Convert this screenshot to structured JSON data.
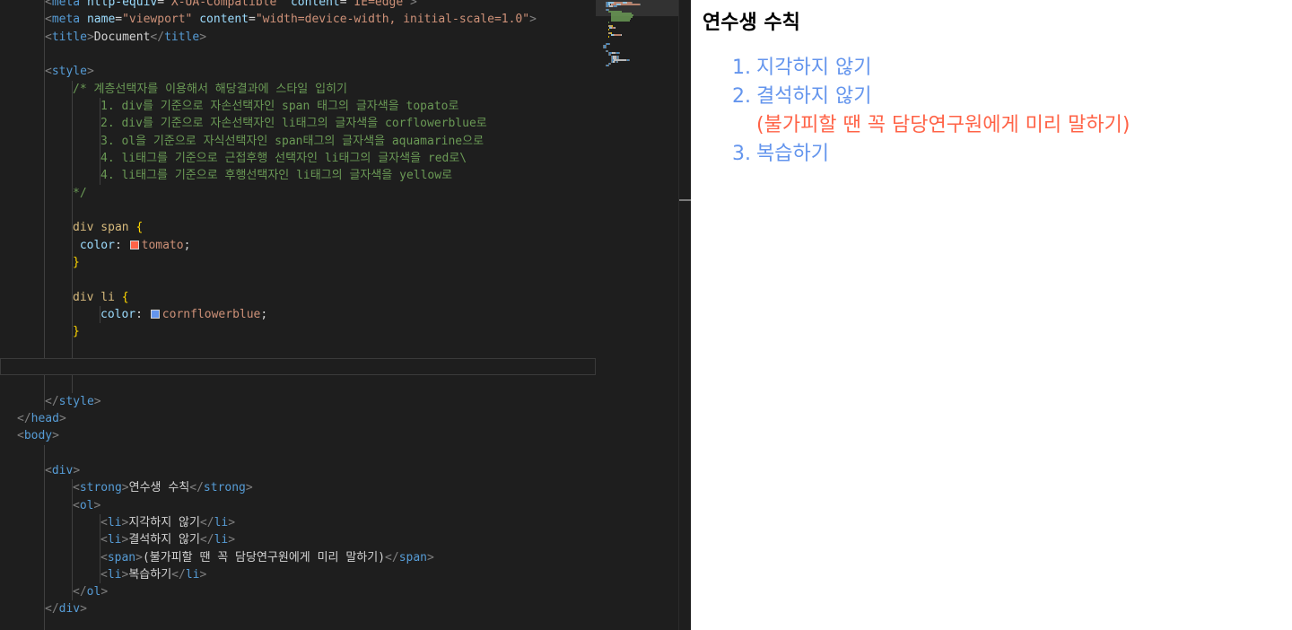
{
  "code_lines": [
    {
      "indent": 1,
      "tokens": [
        [
          "punc",
          "<"
        ],
        [
          "tag",
          "meta"
        ],
        [
          "text",
          " "
        ],
        [
          "attr",
          "http-equiv"
        ],
        [
          "text",
          "="
        ],
        [
          "str",
          "\"X-UA-Compatible\""
        ],
        [
          "text",
          " "
        ],
        [
          "attr",
          "content"
        ],
        [
          "text",
          "="
        ],
        [
          "str",
          "\"IE=edge\""
        ],
        [
          "punc",
          ">"
        ]
      ]
    },
    {
      "indent": 1,
      "tokens": [
        [
          "punc",
          "<"
        ],
        [
          "tag",
          "meta"
        ],
        [
          "text",
          " "
        ],
        [
          "attr",
          "name"
        ],
        [
          "text",
          "="
        ],
        [
          "str",
          "\"viewport\""
        ],
        [
          "text",
          " "
        ],
        [
          "attr",
          "content"
        ],
        [
          "text",
          "="
        ],
        [
          "str",
          "\"width=device-width, initial-scale=1.0\""
        ],
        [
          "punc",
          ">"
        ]
      ]
    },
    {
      "indent": 1,
      "tokens": [
        [
          "punc",
          "<"
        ],
        [
          "tag",
          "title"
        ],
        [
          "punc",
          ">"
        ],
        [
          "text",
          "Document"
        ],
        [
          "punc",
          "</"
        ],
        [
          "tag",
          "title"
        ],
        [
          "punc",
          ">"
        ]
      ]
    },
    {
      "indent": 1,
      "tokens": []
    },
    {
      "indent": 1,
      "tokens": [
        [
          "punc",
          "<"
        ],
        [
          "tag",
          "style"
        ],
        [
          "punc",
          ">"
        ]
      ]
    },
    {
      "indent": 2,
      "tokens": [
        [
          "com",
          "/* 계층선택자를 이용해서 해당결과에 스타일 입히기"
        ]
      ]
    },
    {
      "indent": 3,
      "tokens": [
        [
          "com",
          "1. div를 기준으로 자손선택자인 span 태그의 글자색을 topato로"
        ]
      ]
    },
    {
      "indent": 3,
      "tokens": [
        [
          "com",
          "2. div를 기준으로 자손선택자인 li태그의 글자색을 corflowerblue로"
        ]
      ]
    },
    {
      "indent": 3,
      "tokens": [
        [
          "com",
          "3. ol을 기준으로 자식선택자인 span태그의 글자색을 aquamarine으로"
        ]
      ]
    },
    {
      "indent": 3,
      "tokens": [
        [
          "com",
          "4. li태그를 기준으로 근접후행 선택자인 li태그의 글자색을 red로\\"
        ]
      ]
    },
    {
      "indent": 3,
      "tokens": [
        [
          "com",
          "4. li태그를 기준으로 후행선택자인 li태그의 글자색을 yellow로"
        ]
      ]
    },
    {
      "indent": 2,
      "tokens": [
        [
          "com",
          "*/"
        ]
      ]
    },
    {
      "indent": 2,
      "tokens": []
    },
    {
      "indent": 2,
      "tokens": [
        [
          "sel",
          "div span "
        ],
        [
          "brace",
          "{"
        ]
      ]
    },
    {
      "indent": 2,
      "tokens": [
        [
          "text",
          " "
        ],
        [
          "prop",
          "color"
        ],
        [
          "text",
          ": "
        ],
        [
          "swatch",
          "#ff6347"
        ],
        [
          "val",
          "tomato"
        ],
        [
          "text",
          ";"
        ]
      ]
    },
    {
      "indent": 2,
      "tokens": [
        [
          "brace",
          "}"
        ]
      ]
    },
    {
      "indent": 2,
      "tokens": []
    },
    {
      "indent": 2,
      "tokens": [
        [
          "sel",
          "div li "
        ],
        [
          "brace",
          "{"
        ]
      ]
    },
    {
      "indent": 3,
      "tokens": [
        [
          "prop",
          "color"
        ],
        [
          "text",
          ": "
        ],
        [
          "swatch",
          "#6495ed"
        ],
        [
          "val",
          "cornflowerblue"
        ],
        [
          "text",
          ";"
        ]
      ]
    },
    {
      "indent": 2,
      "tokens": [
        [
          "brace",
          "}"
        ]
      ]
    },
    {
      "indent": 2,
      "tokens": []
    },
    {
      "indent": 0,
      "tokens": [],
      "cursor": true
    },
    {
      "indent": 2,
      "tokens": []
    },
    {
      "indent": 1,
      "tokens": [
        [
          "punc",
          "</"
        ],
        [
          "tag",
          "style"
        ],
        [
          "punc",
          ">"
        ]
      ]
    },
    {
      "indent": 0,
      "tokens": [
        [
          "punc",
          "</"
        ],
        [
          "tag",
          "head"
        ],
        [
          "punc",
          ">"
        ]
      ]
    },
    {
      "indent": 0,
      "tokens": [
        [
          "punc",
          "<"
        ],
        [
          "tag",
          "body"
        ],
        [
          "punc",
          ">"
        ]
      ]
    },
    {
      "indent": 1,
      "tokens": []
    },
    {
      "indent": 1,
      "tokens": [
        [
          "punc",
          "<"
        ],
        [
          "tag",
          "div"
        ],
        [
          "punc",
          ">"
        ]
      ]
    },
    {
      "indent": 2,
      "tokens": [
        [
          "punc",
          "<"
        ],
        [
          "tag",
          "strong"
        ],
        [
          "punc",
          ">"
        ],
        [
          "text",
          "연수생 수칙"
        ],
        [
          "punc",
          "</"
        ],
        [
          "tag",
          "strong"
        ],
        [
          "punc",
          ">"
        ]
      ]
    },
    {
      "indent": 2,
      "tokens": [
        [
          "punc",
          "<"
        ],
        [
          "tag",
          "ol"
        ],
        [
          "punc",
          ">"
        ]
      ]
    },
    {
      "indent": 3,
      "tokens": [
        [
          "punc",
          "<"
        ],
        [
          "tag",
          "li"
        ],
        [
          "punc",
          ">"
        ],
        [
          "text",
          "지각하지 않기"
        ],
        [
          "punc",
          "</"
        ],
        [
          "tag",
          "li"
        ],
        [
          "punc",
          ">"
        ]
      ]
    },
    {
      "indent": 3,
      "tokens": [
        [
          "punc",
          "<"
        ],
        [
          "tag",
          "li"
        ],
        [
          "punc",
          ">"
        ],
        [
          "text",
          "결석하지 않기"
        ],
        [
          "punc",
          "</"
        ],
        [
          "tag",
          "li"
        ],
        [
          "punc",
          ">"
        ]
      ]
    },
    {
      "indent": 3,
      "tokens": [
        [
          "punc",
          "<"
        ],
        [
          "tag",
          "span"
        ],
        [
          "punc",
          ">"
        ],
        [
          "text",
          "(불가피할 땐 꼭 담당연구원에게 미리 말하기)"
        ],
        [
          "punc",
          "</"
        ],
        [
          "tag",
          "span"
        ],
        [
          "punc",
          ">"
        ]
      ]
    },
    {
      "indent": 3,
      "tokens": [
        [
          "punc",
          "<"
        ],
        [
          "tag",
          "li"
        ],
        [
          "punc",
          ">"
        ],
        [
          "text",
          "복습하기"
        ],
        [
          "punc",
          "</"
        ],
        [
          "tag",
          "li"
        ],
        [
          "punc",
          ">"
        ]
      ]
    },
    {
      "indent": 2,
      "tokens": [
        [
          "punc",
          "</"
        ],
        [
          "tag",
          "ol"
        ],
        [
          "punc",
          ">"
        ]
      ]
    },
    {
      "indent": 1,
      "tokens": [
        [
          "punc",
          "</"
        ],
        [
          "tag",
          "div"
        ],
        [
          "punc",
          ">"
        ]
      ]
    },
    {
      "indent": 1,
      "tokens": []
    }
  ],
  "preview": {
    "title": "연수생 수칙",
    "items": [
      {
        "kind": "li",
        "num": "1.",
        "text": "지각하지 않기"
      },
      {
        "kind": "li",
        "num": "2.",
        "text": "결석하지 않기"
      },
      {
        "kind": "span",
        "num": "",
        "text": "(불가피할 땐 꼭 담당연구원에게 미리 말하기)"
      },
      {
        "kind": "li",
        "num": "3.",
        "text": "복습하기"
      }
    ],
    "colors": {
      "li": "#6495ed",
      "span": "#ff6347",
      "title": "#000000"
    }
  },
  "colors": {
    "editor_bg": "#1e1e1e",
    "preview_bg": "#ffffff"
  }
}
